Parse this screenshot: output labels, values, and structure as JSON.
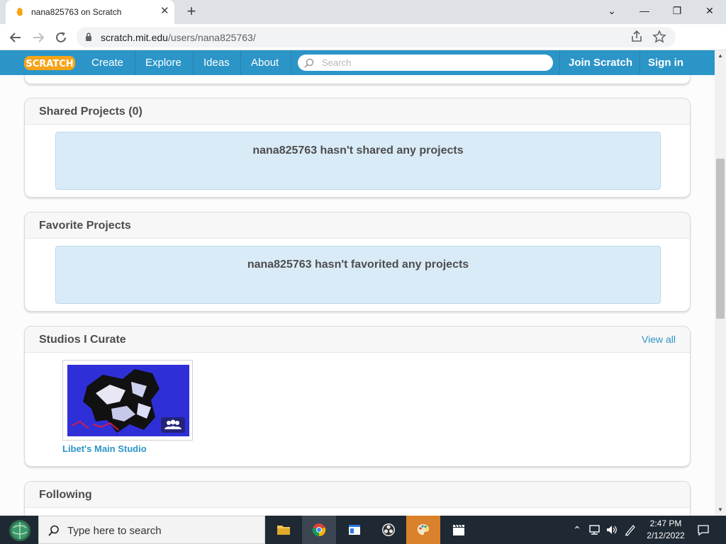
{
  "browser": {
    "tab_title": "nana825763 on Scratch",
    "tab_close": "✕",
    "new_tab": "+",
    "url_host": "scratch.mit.edu",
    "url_path": "/users/nana825763/",
    "window_controls": {
      "minimize": "—",
      "maximize": "❐",
      "close": "✕",
      "tab_list": "⌄"
    }
  },
  "scratch_nav": {
    "logo": "SCRATCH",
    "links": [
      "Create",
      "Explore",
      "Ideas",
      "About"
    ],
    "search_placeholder": "Search",
    "join": "Join Scratch",
    "signin": "Sign in"
  },
  "sections": {
    "shared": {
      "title": "Shared Projects (0)",
      "empty": "nana825763 hasn't shared any projects"
    },
    "favorites": {
      "title": "Favorite Projects",
      "empty": "nana825763 hasn't favorited any projects"
    },
    "studios": {
      "title": "Studios I Curate",
      "view_all": "View all",
      "items": [
        {
          "name": "Libet's Main Studio"
        }
      ]
    },
    "following": {
      "title": "Following"
    }
  },
  "taskbar": {
    "search_placeholder": "Type here to search",
    "time": "2:47 PM",
    "date": "2/12/2022"
  },
  "colors": {
    "scratch_blue": "#2c95c8",
    "empty_bg": "#d9ebf7",
    "taskbar_bg": "#1f2933",
    "highlight_app": "#d9822b"
  }
}
